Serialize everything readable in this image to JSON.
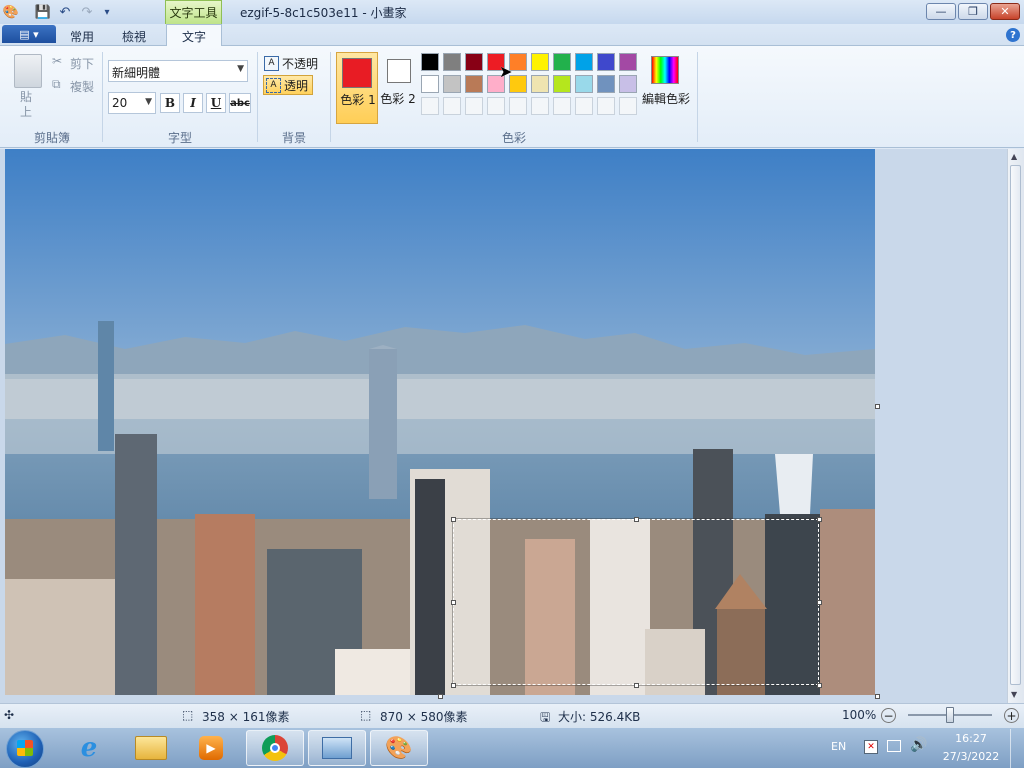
{
  "window": {
    "title": "ezgif-5-8c1c503e11 - 小畫家",
    "contextual_tab_group": "文字工具",
    "minimize": "—",
    "restore": "❐",
    "close": "✕"
  },
  "tabs": {
    "file_label": "▤ ▾",
    "home": "常用",
    "view": "檢視",
    "text": "文字"
  },
  "clipboard": {
    "paste": "貼\n上",
    "cut": "剪下",
    "copy": "複製",
    "group": "剪貼簿"
  },
  "font": {
    "family": "新細明體",
    "size": "20",
    "bold": "B",
    "italic": "I",
    "underline": "U",
    "strike": "abc",
    "group": "字型"
  },
  "background": {
    "opaque": "不透明",
    "transparent": "透明",
    "group": "背景"
  },
  "colors": {
    "color1_label": "色彩 1",
    "color2_label": "色彩 2",
    "edit_colors": "編輯色彩",
    "group": "色彩",
    "color1": "#e81c24",
    "color2": "#ffffff",
    "row1": [
      "#000000",
      "#7f7f7f",
      "#880015",
      "#ed1c24",
      "#ff7f27",
      "#fff200",
      "#22b14c",
      "#00a2e8",
      "#3f48cc",
      "#a349a4"
    ],
    "row2": [
      "#ffffff",
      "#c3c3c3",
      "#b97a57",
      "#ffaec9",
      "#ffc90e",
      "#efe4b0",
      "#b5e61d",
      "#99d9ea",
      "#7092be",
      "#c8bfe7"
    ]
  },
  "status": {
    "selection_size": "358 × 161像素",
    "image_size": "870 × 580像素",
    "file_size": "大小: 526.4KB",
    "zoom": "100%",
    "zoom_level": 0.5
  },
  "taskbar": {
    "lang": "EN",
    "time": "16:27",
    "date": "27/3/2022"
  }
}
